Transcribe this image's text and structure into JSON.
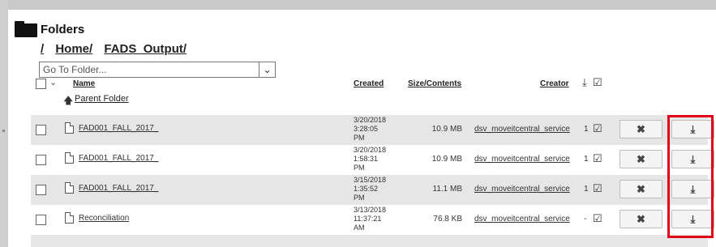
{
  "header": {
    "title": "Folders"
  },
  "breadcrumb": {
    "root": "/",
    "home": "Home/",
    "current": "FADS_Output/"
  },
  "goto": {
    "value": "Go To Folder...",
    "arrow": "⌄"
  },
  "table": {
    "columns": {
      "name": "Name",
      "created": "Created",
      "size": "Size/Contents",
      "creator": "Creator"
    },
    "parent_folder": "Parent Folder",
    "rows": [
      {
        "name": "FAD001_FALL_2017_",
        "created": "3/20/2018 3:28:05 PM",
        "size": "10.9 MB",
        "creator": "dsv_moveitcentral_service",
        "downloads": "1"
      },
      {
        "name": "FAD001_FALL_2017_",
        "created": "3/20/2018 1:58:31 PM",
        "size": "10.9 MB",
        "creator": "dsv_moveitcentral_service",
        "downloads": "1"
      },
      {
        "name": "FAD001_FALL_2017_",
        "created": "3/15/2018 1:35:52 PM",
        "size": "11.1 MB",
        "creator": "dsv_moveitcentral_service",
        "downloads": "1"
      },
      {
        "name": "Reconciliation",
        "created": "3/13/2018 11:37:21 AM",
        "size": "76.8 KB",
        "creator": "dsv_moveitcentral_service",
        "downloads": "-"
      }
    ]
  },
  "colors": {
    "highlight": "#e0001a",
    "row_shade": "#e6e6e6"
  }
}
